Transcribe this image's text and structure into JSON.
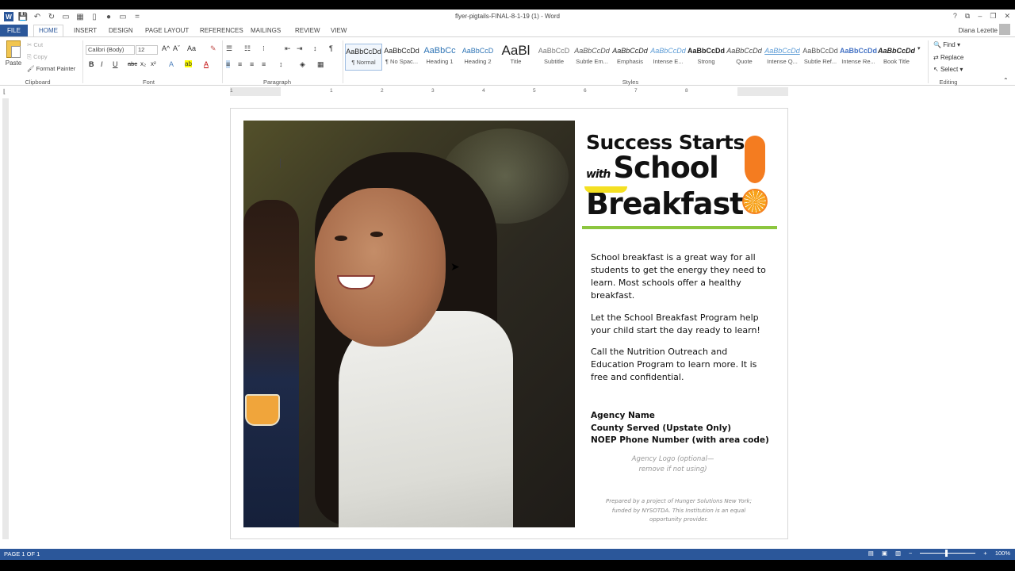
{
  "window": {
    "title": "flyer-pigtails-FINAL-8-1-19 (1) - Word",
    "user": "Diana Lezette",
    "controls": [
      "?",
      "⧉",
      "–",
      "❐",
      "✕"
    ]
  },
  "qat": [
    "W",
    "💾",
    "↶",
    "↻",
    "▭",
    "▦",
    "▯",
    "●",
    "▭",
    "="
  ],
  "tabs": [
    "FILE",
    "HOME",
    "INSERT",
    "DESIGN",
    "PAGE LAYOUT",
    "REFERENCES",
    "MAILINGS",
    "REVIEW",
    "VIEW"
  ],
  "clipboard": {
    "paste": "Paste",
    "cut": "Cut",
    "copy": "Copy",
    "format_painter": "Format Painter",
    "label": "Clipboard"
  },
  "font": {
    "name": "Calibri (Body)",
    "size": "12",
    "label": "Font",
    "buttons": [
      "B",
      "I",
      "U",
      "abc",
      "x₂",
      "x²",
      "A",
      "ab",
      "A"
    ],
    "top_buttons": [
      "A^",
      "Aˇ",
      "Aa",
      "✎"
    ]
  },
  "paragraph": {
    "label": "Paragraph",
    "buttons": [
      "☰",
      "☷",
      "⁝",
      "⇤",
      "⇥",
      "↕",
      "¶"
    ],
    "align": [
      "≡",
      "≡",
      "≡",
      "≡",
      "↕",
      "◈",
      "▦"
    ]
  },
  "styles": {
    "label": "Styles",
    "items": [
      {
        "sample": "AaBbCcDd",
        "name": "¶ Normal"
      },
      {
        "sample": "AaBbCcDd",
        "name": "¶ No Spac..."
      },
      {
        "sample": "AaBbCc",
        "name": "Heading 1"
      },
      {
        "sample": "AaBbCcD",
        "name": "Heading 2"
      },
      {
        "sample": "AaBl",
        "name": "Title"
      },
      {
        "sample": "AaBbCcD",
        "name": "Subtitle"
      },
      {
        "sample": "AaBbCcDd",
        "name": "Subtle Em..."
      },
      {
        "sample": "AaBbCcDd",
        "name": "Emphasis"
      },
      {
        "sample": "AaBbCcDd",
        "name": "Intense E..."
      },
      {
        "sample": "AaBbCcDd",
        "name": "Strong"
      },
      {
        "sample": "AaBbCcDd",
        "name": "Quote"
      },
      {
        "sample": "AaBbCcDd",
        "name": "Intense Q..."
      },
      {
        "sample": "AaBbCcDd",
        "name": "Subtle Ref..."
      },
      {
        "sample": "AaBbCcDd",
        "name": "Intense Re..."
      },
      {
        "sample": "AaBbCcDd",
        "name": "Book Title"
      }
    ]
  },
  "editing": {
    "label": "Editing",
    "find": "Find",
    "replace": "Replace",
    "select": "Select"
  },
  "ruler": [
    "1",
    "1",
    "2",
    "3",
    "4",
    "5",
    "6",
    "7",
    "8"
  ],
  "flyer": {
    "line1": "Success Starts",
    "with": "with",
    "line2": "School",
    "line3": "Breakfast",
    "para1": "School breakfast is a great way for all students to get the energy they need to learn. Most schools offer a healthy breakfast.",
    "para2": "Let the School Breakfast Program help your child start the day ready to learn!",
    "para3": "Call the Nutrition Outreach and Education Program to learn more. It is free and confidential.",
    "agency_name": "Agency Name",
    "county": "County Served (Upstate Only)",
    "phone": "NOEP Phone Number (with area code)",
    "logo_note": "Agency Logo (optional—remove if not using)",
    "prepared": "Prepared by a project of Hunger Solutions New York; funded by NYSOTDA. This Institution is an equal opportunity provider."
  },
  "status": {
    "page": "PAGE 1 OF 1",
    "zoom": "100%"
  },
  "colors": {
    "word_blue": "#2b579a",
    "accent_green": "#8cc63f",
    "accent_orange": "#f47c20",
    "accent_yellow": "#f4e022"
  }
}
